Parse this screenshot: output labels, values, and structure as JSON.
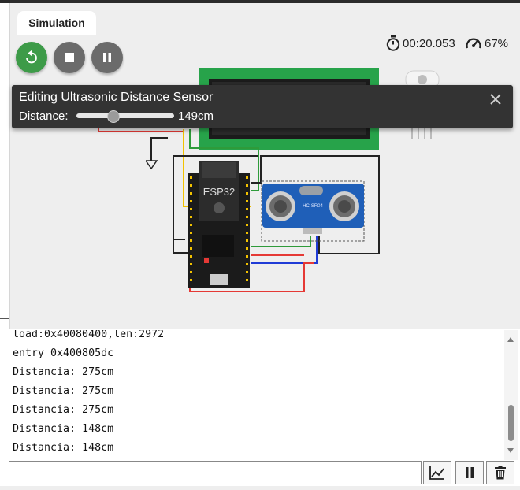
{
  "tab": {
    "label": "Simulation"
  },
  "controls": {
    "restart": "restart-icon",
    "stop": "stop-icon",
    "pause": "pause-icon"
  },
  "status": {
    "timer": "00:20.053",
    "speed": "67%"
  },
  "popup": {
    "title": "Editing Ultrasonic Distance Sensor",
    "distance_label": "Distance:",
    "distance_value": "149cm",
    "slider_fraction": 0.37
  },
  "circuit": {
    "chip_label": "ESP32",
    "sensor_label": "HC-SR04"
  },
  "console": {
    "lines": [
      "load:0x40080400,len:2972",
      "entry 0x400805dc",
      "Distancia: 275cm",
      "Distancia: 275cm",
      "Distancia: 275cm",
      "Distancia: 148cm",
      "Distancia: 148cm"
    ],
    "input_value": ""
  },
  "colors": {
    "green": "#3d9b48",
    "gray": "#6b6b6b",
    "popup": "#333333",
    "lcd": "#27a34a"
  },
  "icons": {
    "plot": "chart-icon",
    "pause": "pause-icon",
    "clear": "trash-icon"
  }
}
